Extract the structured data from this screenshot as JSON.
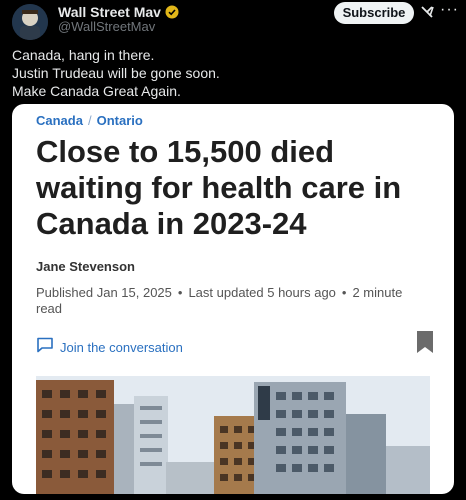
{
  "author": {
    "name": "Wall Street Mav",
    "handle": "@WallStreetMav",
    "subscribe_label": "Subscribe",
    "grok_icon": "grok-icon",
    "more_icon": "more-icon"
  },
  "tweet": {
    "lines": [
      "Canada, hang in there.",
      "Justin Trudeau will be gone soon.",
      "Make Canada Great Again."
    ]
  },
  "article": {
    "breadcrumb": [
      "Canada",
      "Ontario"
    ],
    "breadcrumb_separator": "/",
    "headline_lines": [
      "Close to 15,500 died",
      "waiting for health care in",
      "Canada in 2023-24"
    ],
    "byline": "Jane Stevenson",
    "published": "Published Jan 15, 2025",
    "updated": "Last updated 5 hours ago",
    "read_time_a": "2 minute",
    "read_time_b": "read",
    "join_label": "Join the conversation"
  },
  "colors": {
    "background": "#000000",
    "link_blue": "#2a70c0",
    "verified_gold": "#e2b719"
  }
}
